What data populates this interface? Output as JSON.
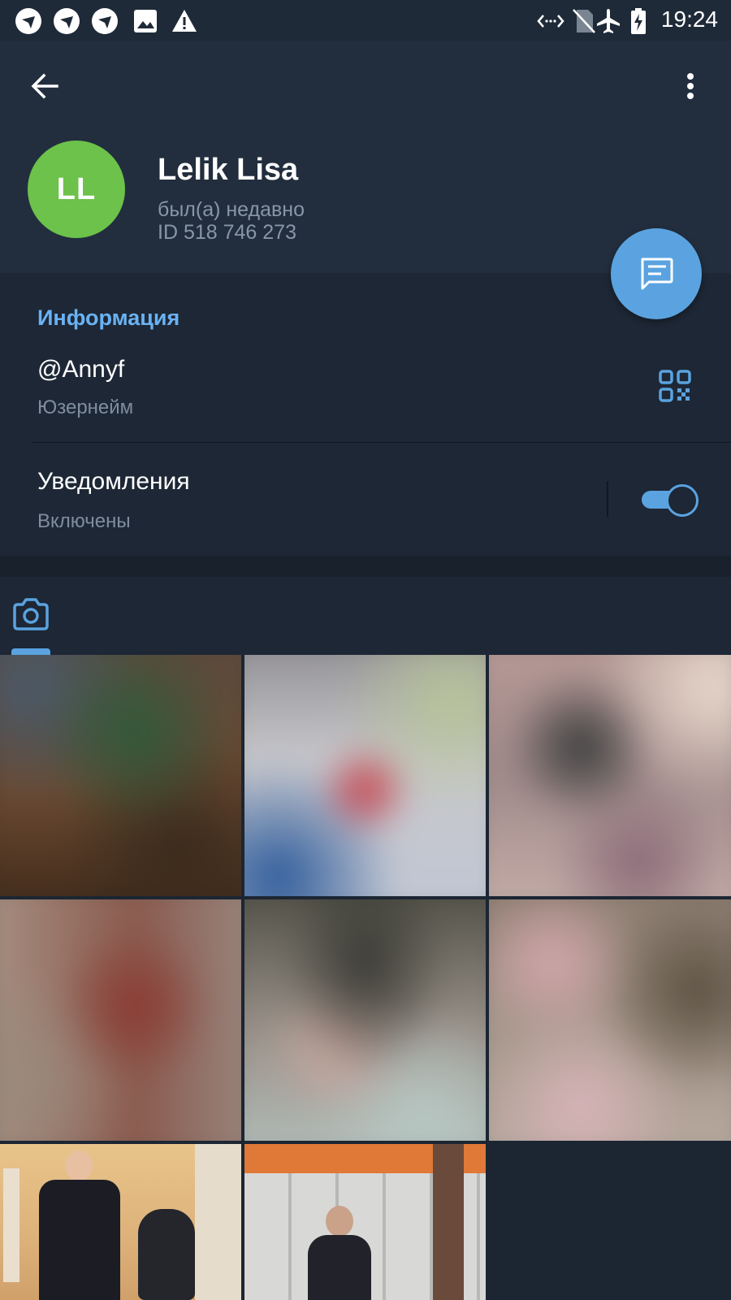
{
  "status_bar": {
    "time": "19:24",
    "left_icons": [
      "app-notification-icon",
      "app-notification-icon",
      "app-notification-icon",
      "image-icon",
      "warning-icon"
    ],
    "right_icons": [
      "data-transfer-icon",
      "no-sim-icon",
      "airplane-mode-icon",
      "battery-charging-icon"
    ]
  },
  "toolbar": {
    "back_icon": "arrow-left-icon",
    "more_icon": "more-vertical-icon"
  },
  "profile": {
    "avatar_initials": "LL",
    "avatar_color": "#6cc24a",
    "name": "Lelik Lisa",
    "last_seen": "был(а) недавно",
    "user_id": "ID 518 746 273"
  },
  "fab": {
    "icon": "message-icon",
    "color": "#5aa3e0"
  },
  "info": {
    "section_title": "Информация",
    "username": "@Annyf",
    "username_label": "Юзернейм",
    "qr_icon": "qr-code-icon",
    "notifications_title": "Уведомления",
    "notifications_status": "Включены",
    "notifications_enabled": true
  },
  "media": {
    "active_tab_icon": "camera-icon",
    "accent_color": "#5aa3e0",
    "items": [
      {
        "type": "photo",
        "blurred": true
      },
      {
        "type": "photo",
        "blurred": true
      },
      {
        "type": "photo",
        "blurred": true
      },
      {
        "type": "photo",
        "blurred": true
      },
      {
        "type": "photo",
        "blurred": true
      },
      {
        "type": "photo",
        "blurred": true
      },
      {
        "type": "photo",
        "blurred": false
      },
      {
        "type": "photo",
        "blurred": false
      }
    ]
  }
}
